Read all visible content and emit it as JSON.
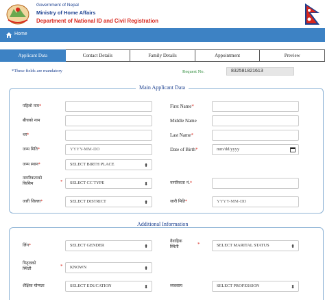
{
  "header": {
    "government": "Government of Nepal",
    "ministry": "Ministry of Home Affairs",
    "department": "Department of National ID and Civil Registration"
  },
  "nav": {
    "home_label": "Home"
  },
  "tabs": [
    {
      "label": "Applicant Data",
      "active": true
    },
    {
      "label": "Contact Details",
      "active": false
    },
    {
      "label": "Family Details",
      "active": false
    },
    {
      "label": "Appointment",
      "active": false
    },
    {
      "label": "Preview",
      "active": false
    }
  ],
  "info": {
    "mandatory_note": "*These fields are mandatory",
    "request_label": "Request No.",
    "request_value": "832581821613"
  },
  "main_applicant": {
    "legend": "Main Applicant Data",
    "first_name_np": "पहिलो नाम",
    "first_name_en": "First Name",
    "middle_name_np": "बीचको नाम",
    "middle_name_en": "Middle Name",
    "last_name_np": "थर",
    "last_name_en": "Last Name",
    "dob_np": "जन्म मिति",
    "dob_np_placeholder": "YYYY-MM-DD",
    "dob_en": "Date of Birth",
    "dob_en_placeholder": "mm/dd/yyyy",
    "birth_place_label": "जन्म स्थान",
    "birth_place_value": "SELECT BIRTH PLACE",
    "cc_type_label_1": "नागरिकताको",
    "cc_type_label_2": "किसिम",
    "cc_type_value": "SELECT CC TYPE",
    "cc_no_label": "नागरिकता नं.",
    "issue_district_label": "जारी जिल्ला",
    "issue_district_value": "SELECT DISTRICT",
    "issue_date_label": "जारी मिति",
    "issue_date_placeholder": "YYYY-MM-DD"
  },
  "additional": {
    "legend": "Additional Information",
    "gender_label": "लिंग",
    "gender_value": "SELECT GENDER",
    "marital_label_1": "वैवाहिक",
    "marital_label_2": "स्थिती",
    "marital_value": "SELECT MARITAL STATUS",
    "paternal_label_1": "पितृत्वको",
    "paternal_label_2": "स्थिती",
    "paternal_value": "KNOWN",
    "education_label": "शैक्षिक योग्यता",
    "education_value": "SELECT EDUCATION",
    "profession_label": "व्यवसाय",
    "profession_value": "SELECT PROFESSION"
  }
}
